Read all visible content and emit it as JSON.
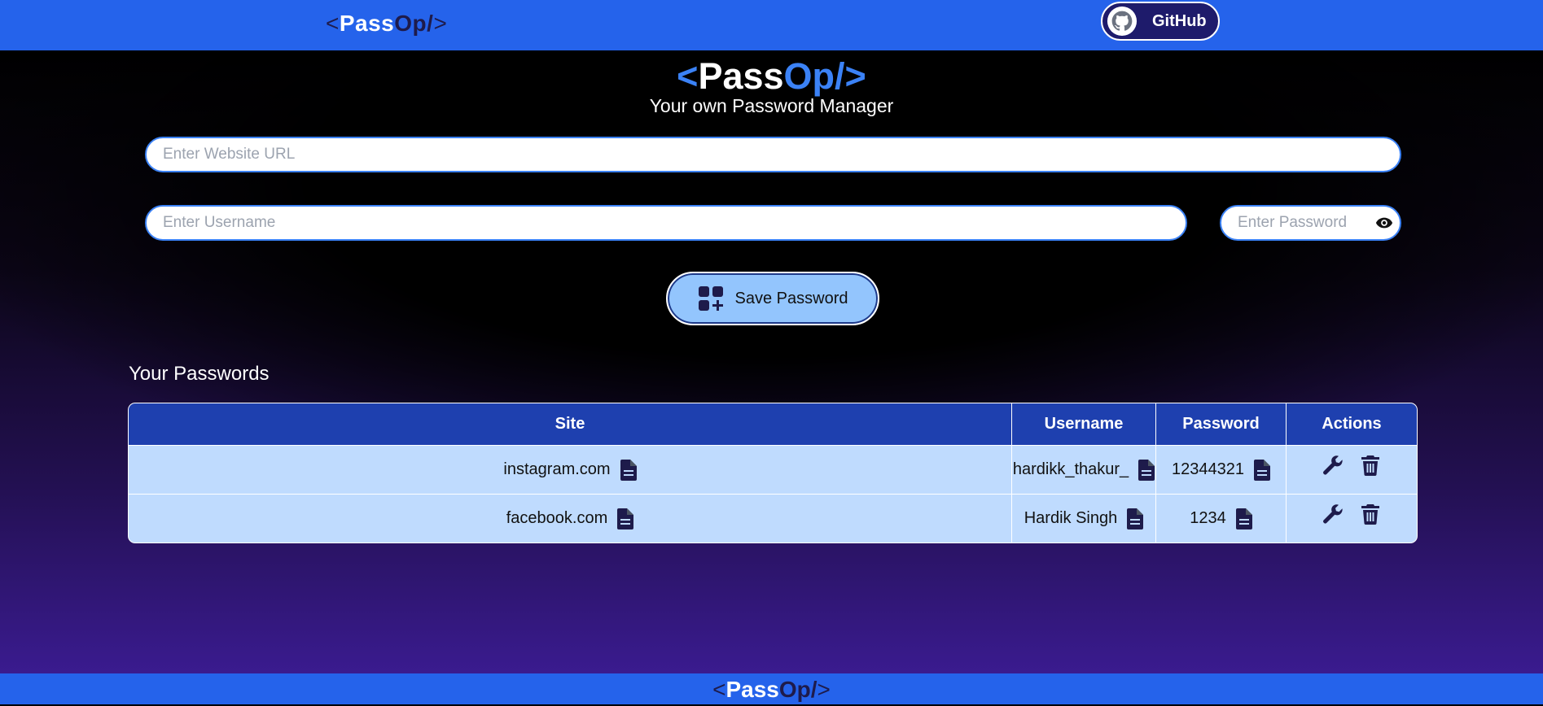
{
  "navbar": {
    "logo": {
      "open": "<",
      "pass": "Pass",
      "op": "Op/",
      "close": ">"
    },
    "github_label": "GitHub"
  },
  "hero": {
    "logo": {
      "open": "<",
      "pass": "Pass",
      "op": "Op/",
      "close": ">"
    },
    "subtitle": "Your own Password Manager"
  },
  "form": {
    "url_placeholder": "Enter Website URL",
    "url_value": "",
    "username_placeholder": "Enter Username",
    "username_value": "",
    "password_placeholder": "Enter Password",
    "password_value": "",
    "save_label": "Save Password"
  },
  "passwords": {
    "title": "Your Passwords",
    "columns": [
      "Site",
      "Username",
      "Password",
      "Actions"
    ],
    "rows": [
      {
        "site": "instagram.com",
        "username": "hardikk_thakur_",
        "password": "12344321"
      },
      {
        "site": "facebook.com",
        "username": "Hardik Singh",
        "password": "1234"
      }
    ]
  },
  "footer": {
    "logo": {
      "open": "<",
      "pass": "Pass",
      "op": "Op/",
      "close": ">"
    }
  },
  "icons": {
    "github": "github-icon",
    "eye": "eye-icon",
    "save": "grid-plus-icon",
    "copy": "document-icon",
    "edit": "wrench-icon",
    "delete": "trash-icon"
  },
  "colors": {
    "nav": "#2563eb",
    "accent": "#3b82f6",
    "table_header": "#1e40af",
    "table_row": "#bfdbfe",
    "save_button": "#93c5fd"
  }
}
